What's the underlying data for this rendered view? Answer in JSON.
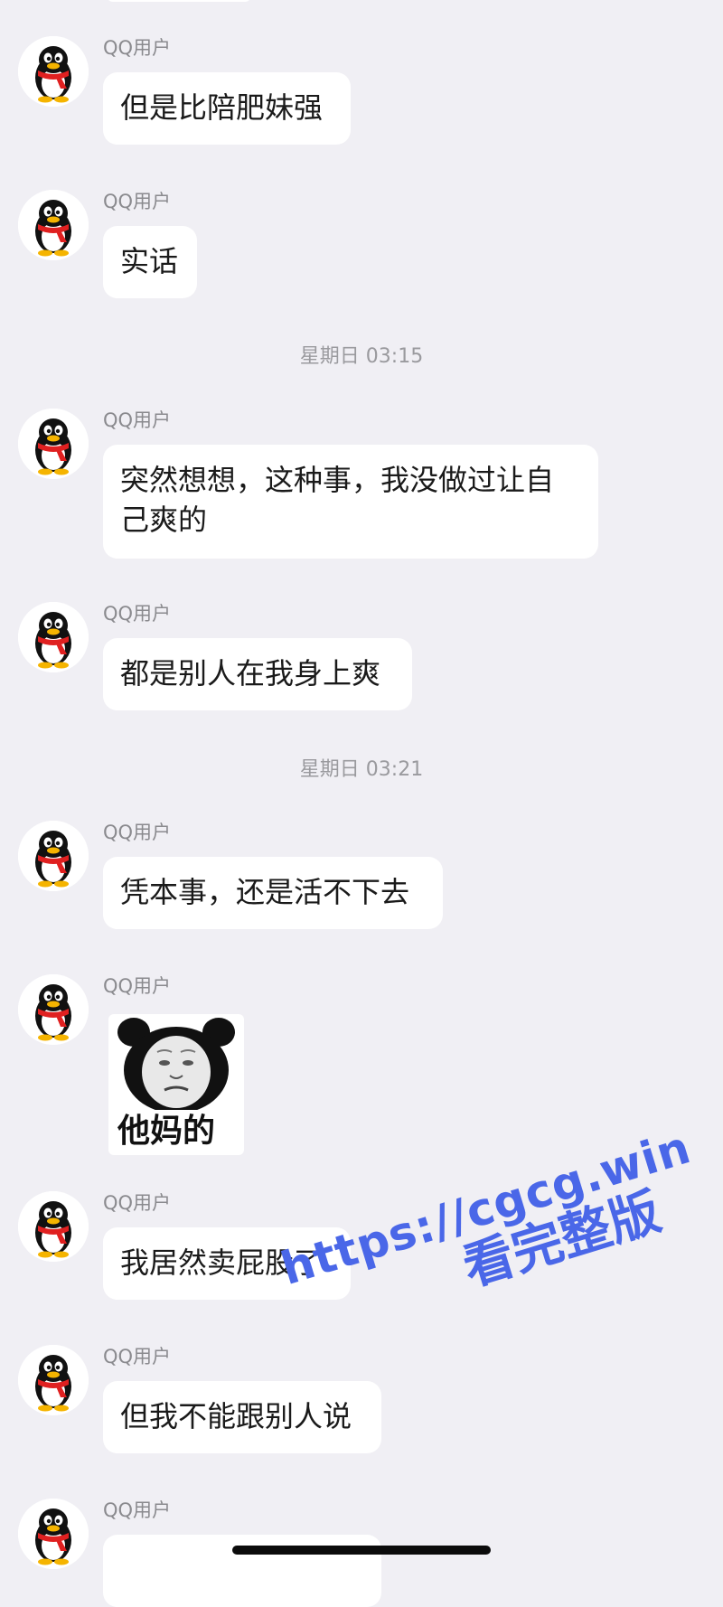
{
  "theme": {
    "background": "#f0eff4",
    "bubble": "#ffffff",
    "sender_color": "#8a8a8e",
    "watermark_color": "#4a67e8"
  },
  "messages": [
    {
      "sender": "QQ用户",
      "text": "但是比陪肥妹强",
      "avatar_icon": "qq-penguin-icon"
    },
    {
      "sender": "QQ用户",
      "text": "实话",
      "avatar_icon": "qq-penguin-icon"
    },
    {
      "sender": "QQ用户",
      "text": "突然想想，这种事，我没做过让自己爽的",
      "avatar_icon": "qq-penguin-icon"
    },
    {
      "sender": "QQ用户",
      "text": "都是别人在我身上爽",
      "avatar_icon": "qq-penguin-icon"
    },
    {
      "sender": "QQ用户",
      "text": "凭本事，还是活不下去",
      "avatar_icon": "qq-penguin-icon"
    },
    {
      "sender": "QQ用户",
      "sticker_caption": "他妈的",
      "sticker_icon": "panda-meme-sticker",
      "avatar_icon": "qq-penguin-icon"
    },
    {
      "sender": "QQ用户",
      "text": "我居然卖屁股了",
      "avatar_icon": "qq-penguin-icon"
    },
    {
      "sender": "QQ用户",
      "text": "但我不能跟别人说",
      "avatar_icon": "qq-penguin-icon"
    },
    {
      "sender": "QQ用户",
      "avatar_icon": "qq-penguin-icon"
    }
  ],
  "timestamps": [
    "星期日 03:15",
    "星期日 03:21"
  ],
  "watermark": {
    "url": "https://cgcg.win",
    "text": "看完整版"
  }
}
